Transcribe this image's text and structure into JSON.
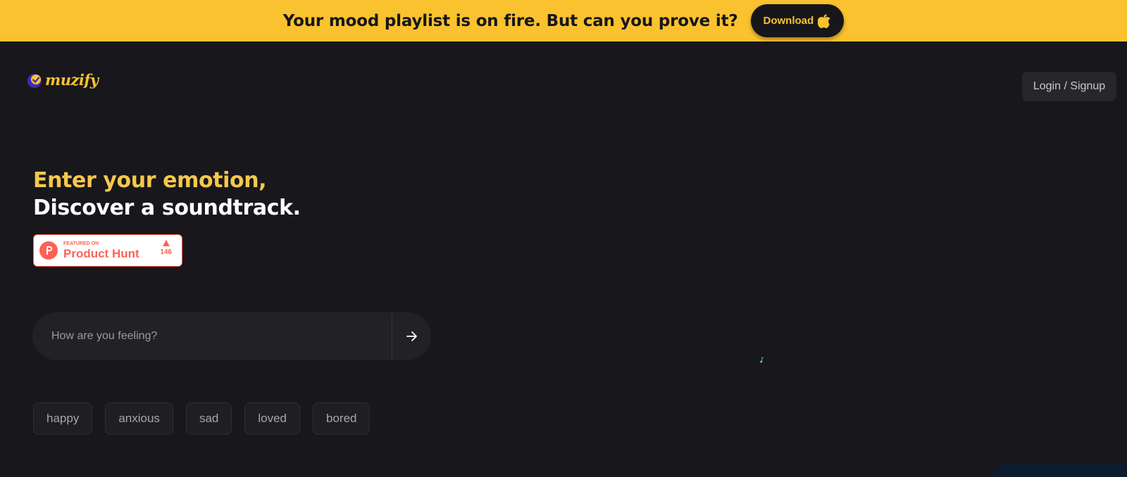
{
  "banner": {
    "text": "Your mood playlist is on fire. But can you prove it?",
    "download_label": "Download",
    "download_icon": "apple-icon",
    "background_color": "#fbc22f"
  },
  "header": {
    "logo_text": "muzify",
    "logo_icon": "muzify-logo-icon",
    "login_label": "Login / Signup"
  },
  "hero": {
    "line1": "Enter your emotion,",
    "line2": "Discover a soundtrack.",
    "accent_color": "#f5c84c"
  },
  "product_hunt": {
    "featured_label": "FEATURED ON",
    "name": "Product Hunt",
    "votes": "146",
    "icon": "product-hunt-logo-icon",
    "brand_color": "#ff6154"
  },
  "search": {
    "placeholder": "How are you feeling?",
    "value": "",
    "submit_icon": "arrow-right-icon"
  },
  "moods": [
    {
      "label": "happy"
    },
    {
      "label": "anxious"
    },
    {
      "label": "sad"
    },
    {
      "label": "loved"
    },
    {
      "label": "bored"
    }
  ],
  "colors": {
    "background": "#18171c",
    "surface": "#222126",
    "accent": "#fbc22f"
  }
}
